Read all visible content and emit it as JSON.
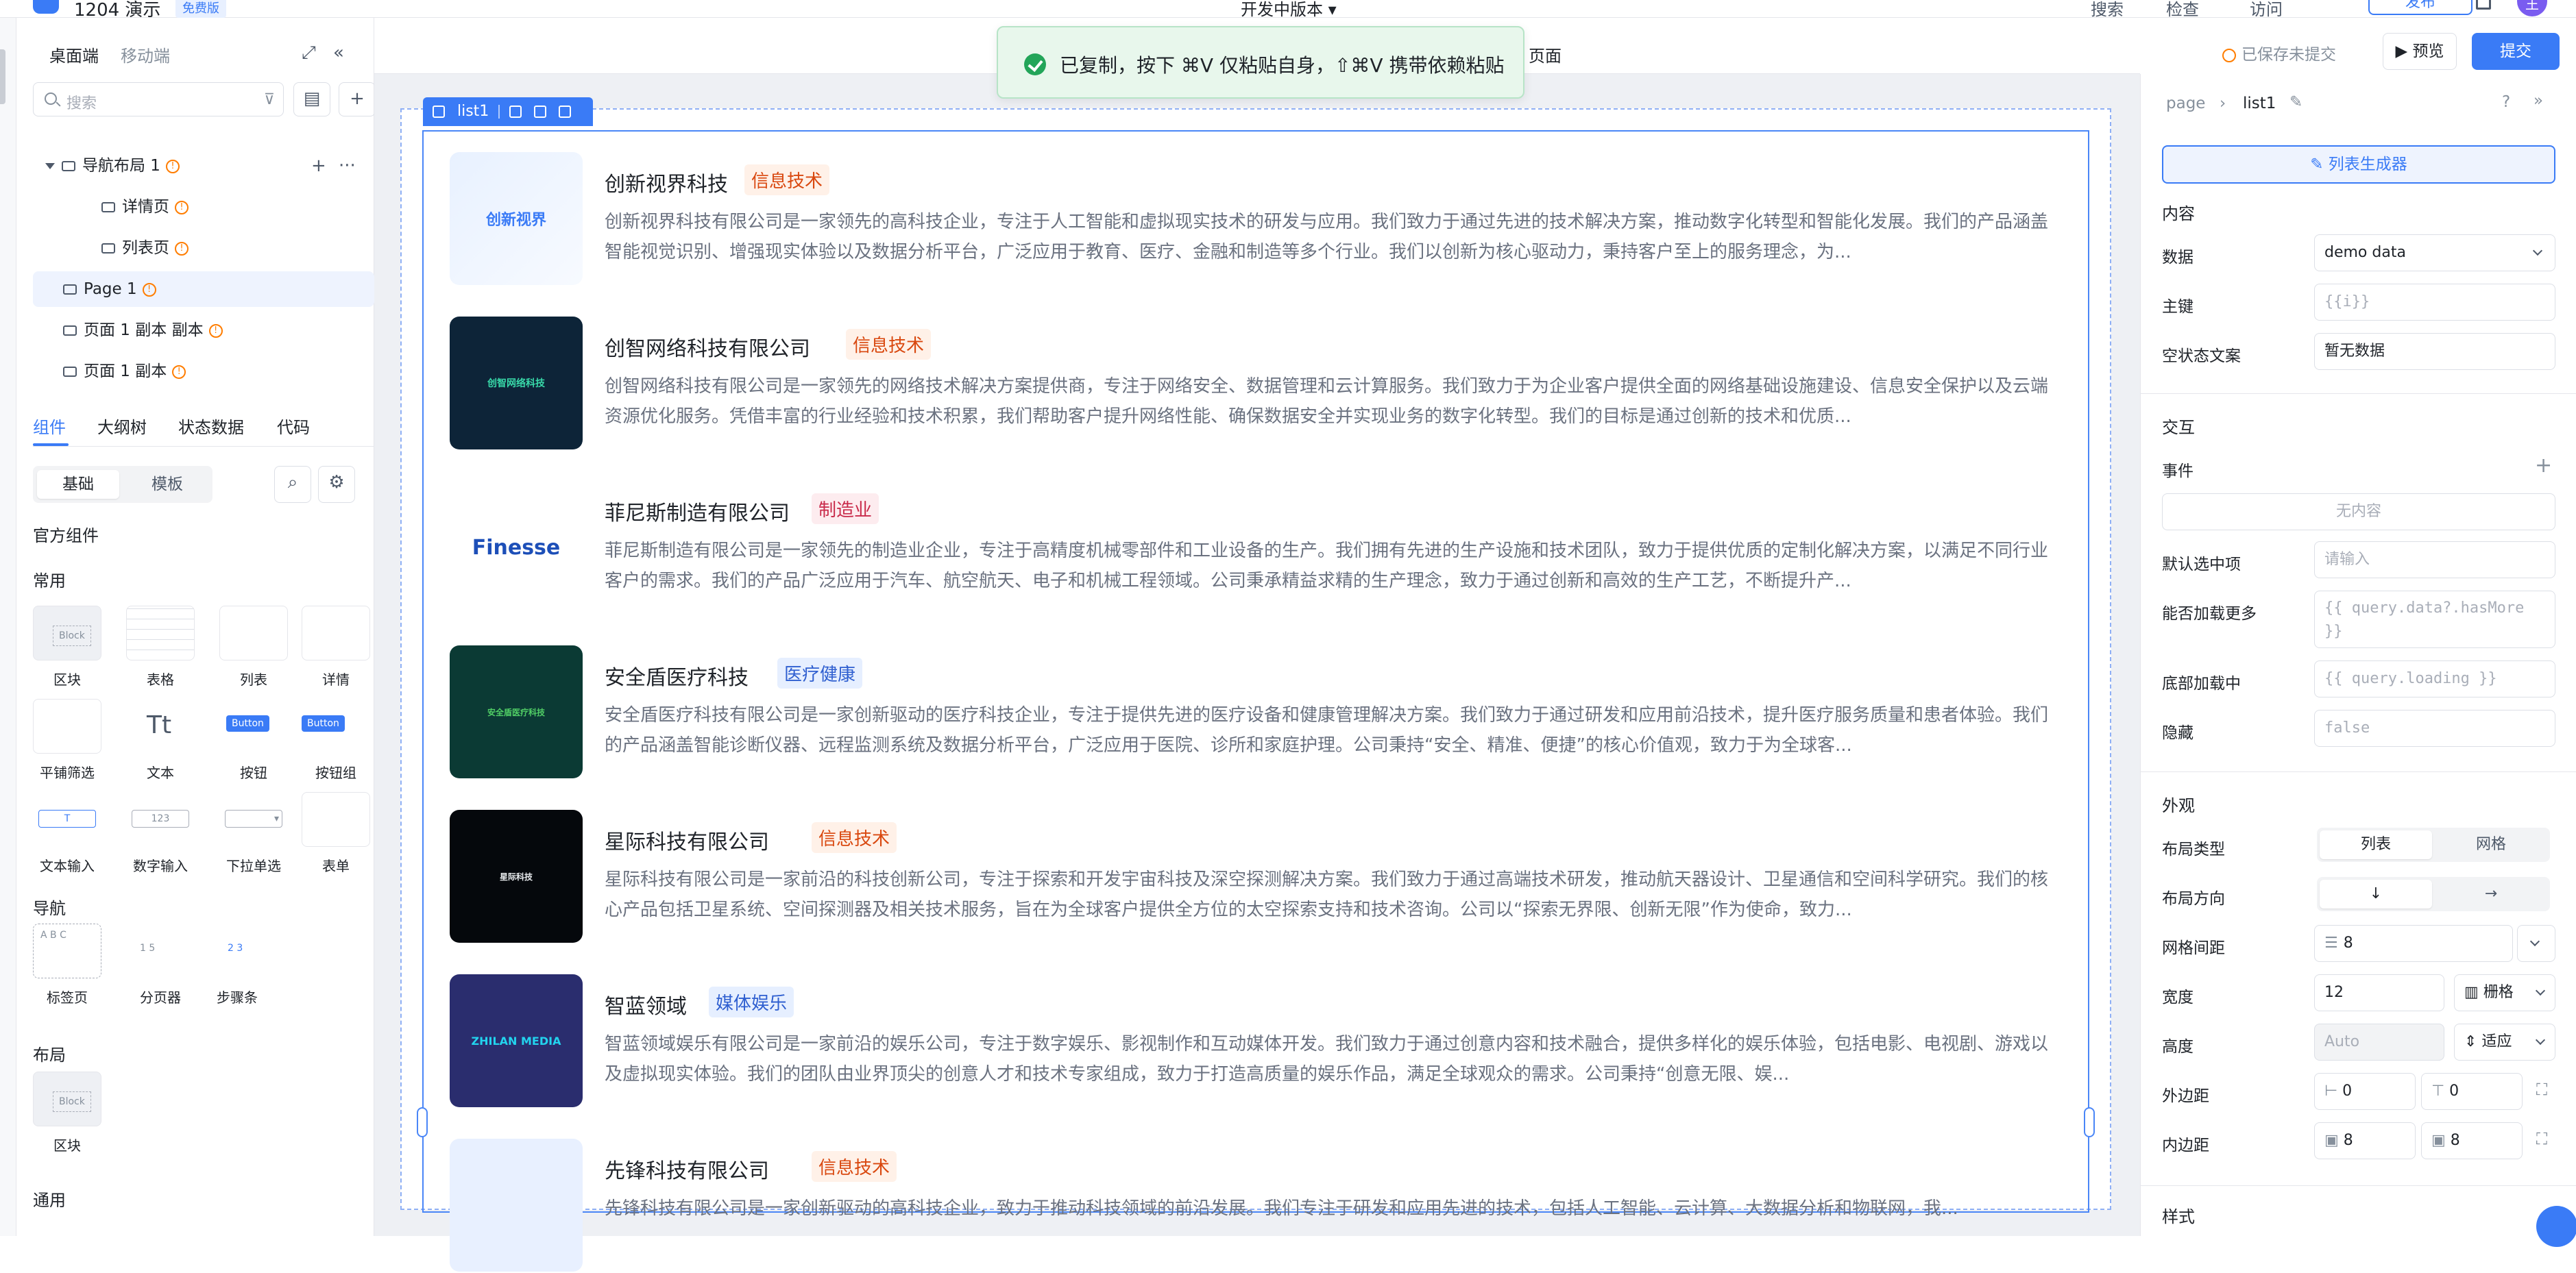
{
  "topbar": {
    "app_title": "1204 演示",
    "app_badge": "免费版",
    "center_label": "开发中版本 ▾",
    "search": "搜索",
    "check": "检查",
    "visit": "访问",
    "publish": "发布",
    "avatar": "王"
  },
  "left_panel": {
    "tab_desktop": "桌面端",
    "tab_mobile": "移动端",
    "search_placeholder": "搜索",
    "tree": [
      {
        "label": "导航布局 1"
      },
      {
        "label": "详情页"
      },
      {
        "label": "列表页"
      },
      {
        "label": "Page 1"
      },
      {
        "label": "页面 1 副本 副本"
      },
      {
        "label": "页面 1 副本"
      }
    ],
    "tabs": [
      "组件",
      "大纲树",
      "状态数据",
      "代码"
    ],
    "seg": [
      "基础",
      "模板"
    ],
    "section_official": "官方组件",
    "section_common": "常用",
    "common": [
      "区块",
      "表格",
      "列表",
      "详情",
      "平铺筛选",
      "文本",
      "按钮",
      "按钮组",
      "文本输入",
      "数字输入",
      "下拉单选",
      "表单"
    ],
    "section_nav": "导航",
    "nav": [
      "标签页",
      "分页器",
      "步骤条"
    ],
    "section_layout": "布局",
    "layout": [
      "区块"
    ],
    "section_general": "通用",
    "mini": {
      "block": "Block",
      "text": "Tt",
      "button": "Button",
      "num": "123",
      "pager": "1  5",
      "step": "2  3",
      "abc": "A  B  C"
    }
  },
  "toast": {
    "message": "已复制，按下 ⌘V 仅粘贴自身，⇧⌘V 携带依赖粘贴"
  },
  "page_header": {
    "title": "页面",
    "saved": "已保存未提交",
    "preview": "预览",
    "submit": "提交"
  },
  "list": {
    "tag": "list1",
    "items": [
      {
        "name": "创新视界科技",
        "tag": "信息技术",
        "tag_type": "it",
        "logo_text": "创新视界",
        "desc": "创新视界科技有限公司是一家领先的高科技企业，专注于人工智能和虚拟现实技术的研发与应用。我们致力于通过先进的技术解决方案，推动数字化转型和智能化发展。我们的产品涵盖智能视觉识别、增强现实体验以及数据分析平台，广泛应用于教育、医疗、金融和制造等多个行业。我们以创新为核心驱动力，秉持客户至上的服务理念，为..."
      },
      {
        "name": "创智网络科技有限公司",
        "tag": "信息技术",
        "tag_type": "it",
        "logo_text": "创智网络科技",
        "desc": "创智网络科技有限公司是一家领先的网络技术解决方案提供商，专注于网络安全、数据管理和云计算服务。我们致力于为企业客户提供全面的网络基础设施建设、信息安全保护以及云端资源优化服务。凭借丰富的行业经验和技术积累，我们帮助客户提升网络性能、确保数据安全并实现业务的数字化转型。我们的目标是通过创新的技术和优质..."
      },
      {
        "name": "菲尼斯制造有限公司",
        "tag": "制造业",
        "tag_type": "mfg",
        "logo_text": "Finesse",
        "desc": "菲尼斯制造有限公司是一家领先的制造业企业，专注于高精度机械零部件和工业设备的生产。我们拥有先进的生产设施和技术团队，致力于提供优质的定制化解决方案，以满足不同行业客户的需求。我们的产品广泛应用于汽车、航空航天、电子和机械工程领域。公司秉承精益求精的生产理念，致力于通过创新和高效的生产工艺，不断提升产..."
      },
      {
        "name": "安全盾医疗科技",
        "tag": "医疗健康",
        "tag_type": "med",
        "logo_text": "安全盾医疗科技",
        "desc": "安全盾医疗科技有限公司是一家创新驱动的医疗科技企业，专注于提供先进的医疗设备和健康管理解决方案。我们致力于通过研发和应用前沿技术，提升医疗服务质量和患者体验。我们的产品涵盖智能诊断仪器、远程监测系统及数据分析平台，广泛应用于医院、诊所和家庭护理。公司秉持“安全、精准、便捷”的核心价值观，致力于为全球客..."
      },
      {
        "name": "星际科技有限公司",
        "tag": "信息技术",
        "tag_type": "it",
        "logo_text": "星际科技",
        "desc": "星际科技有限公司是一家前沿的科技创新公司，专注于探索和开发宇宙科技及深空探测解决方案。我们致力于通过高端技术研发，推动航天器设计、卫星通信和空间科学研究。我们的核心产品包括卫星系统、空间探测器及相关技术服务，旨在为全球客户提供全方位的太空探索支持和技术咨询。公司以“探索无界限、创新无限”作为使命，致力..."
      },
      {
        "name": "智蓝领域",
        "tag": "媒体娱乐",
        "tag_type": "media",
        "logo_text": "ZHILAN MEDIA",
        "desc": "智蓝领域娱乐有限公司是一家前沿的娱乐公司，专注于数字娱乐、影视制作和互动媒体开发。我们致力于通过创意内容和技术融合，提供多样化的娱乐体验，包括电影、电视剧、游戏以及虚拟现实体验。我们的团队由业界顶尖的创意人才和技术专家组成，致力于打造高质量的娱乐作品，满足全球观众的需求。公司秉持“创意无限、娱..."
      },
      {
        "name": "先锋科技有限公司",
        "tag": "信息技术",
        "tag_type": "it",
        "logo_text": "",
        "desc": "先锋科技有限公司是一家创新驱动的高科技企业，致力于推动科技领域的前沿发展。我们专注于研发和应用先进的技术，包括人工智能、云计算、大数据分析和物联网，我..."
      }
    ]
  },
  "right_panel": {
    "crumb_page": "page",
    "crumb_current": "list1",
    "generator": "列表生成器",
    "sec_content": "内容",
    "data_label": "数据",
    "data_value": "demo data",
    "key_label": "主键",
    "key_value": "{{i}}",
    "empty_label": "空状态文案",
    "empty_value": "暂无数据",
    "sec_interact": "交互",
    "event_label": "事件",
    "event_empty": "无内容",
    "default_label": "默认选中项",
    "default_ph": "请输入",
    "loadmore_label": "能否加载更多",
    "loadmore_value": "{{ query.data?.hasMore }}",
    "bottom_label": "底部加载中",
    "bottom_value": "{{ query.loading }}",
    "hidden_label": "隐藏",
    "hidden_value": "false",
    "sec_appearance": "外观",
    "layout_type_label": "布局类型",
    "layout_list": "列表",
    "layout_grid": "网格",
    "direction_label": "布局方向",
    "dir_down": "↓",
    "dir_right": "→",
    "gap_label": "网格间距",
    "gap_value": "8",
    "width_label": "宽度",
    "width_value": "12",
    "width_unit": "栅格",
    "height_label": "高度",
    "height_value": "Auto",
    "height_mode": "适应",
    "margin_label": "外边距",
    "margin_a": "0",
    "margin_b": "0",
    "padding_label": "内边距",
    "padding_a": "8",
    "padding_b": "8",
    "sec_style": "样式"
  }
}
